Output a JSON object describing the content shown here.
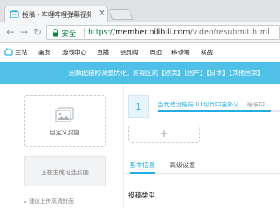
{
  "browser": {
    "tab_title": "投稿 - 哔哩哔哩弹幕视频网",
    "tab_close_label": "×",
    "url_secure_label": "安全",
    "url_protocol": "https://",
    "url_host": "member.bilibili.com",
    "url_path": "/video/resubmit.html"
  },
  "sitenav": {
    "items": [
      "主站",
      "画友",
      "游戏中心",
      "直播",
      "会员购",
      "周边",
      "移动端",
      "萌战"
    ]
  },
  "banner": {
    "text": "因数据结构调整优化，影视区的【欧美】【国产】【日本】【其他国家】"
  },
  "cover": {
    "custom_label": "自定义封面",
    "generating_label": "正在生成可选封面",
    "tip": "建议上传高清封面"
  },
  "upload": {
    "part_number": "1",
    "part_name": "当代政治格局.01现代中国外交...",
    "part_status": "等候中",
    "progress_fraction": 0.92,
    "add_label": "+"
  },
  "tabs": {
    "basic": "基本信息",
    "advanced": "高级设置"
  },
  "section": {
    "title": "投稿类型"
  },
  "colors": {
    "accent": "#23ade5",
    "banner": "#4fc1e9",
    "secure": "#0b8043"
  }
}
